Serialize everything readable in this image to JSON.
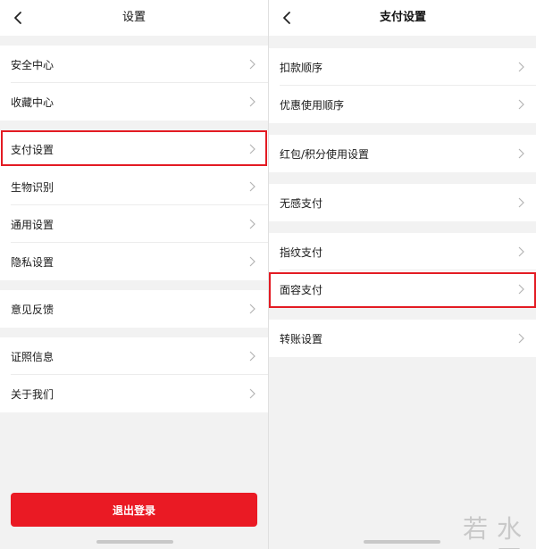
{
  "left": {
    "title": "设置",
    "groups": [
      [
        "安全中心",
        "收藏中心"
      ],
      [
        "支付设置",
        "生物识别",
        "通用设置",
        "隐私设置"
      ],
      [
        "意见反馈"
      ],
      [
        "证照信息",
        "关于我们"
      ]
    ],
    "logout_label": "退出登录"
  },
  "right": {
    "title": "支付设置",
    "items": [
      "扣款顺序",
      "优惠使用顺序",
      "红包/积分使用设置",
      "无感支付",
      "指纹支付",
      "面容支付",
      "转账设置"
    ]
  },
  "watermark": "若水网",
  "accent_color": "#ea1a24"
}
